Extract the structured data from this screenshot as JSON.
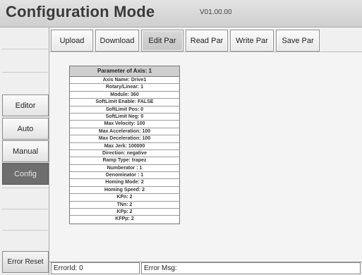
{
  "header": {
    "title": "Configuration Mode",
    "version": "V01.00.00"
  },
  "toolbar": {
    "buttons": [
      {
        "label": "Upload"
      },
      {
        "label": "Download"
      },
      {
        "label": "Edit Par"
      },
      {
        "label": "Read Par"
      },
      {
        "label": "Write Par"
      },
      {
        "label": "Save Par"
      }
    ],
    "active": "Edit Par"
  },
  "nav": {
    "items": [
      {
        "label": "Editor"
      },
      {
        "label": "Auto"
      },
      {
        "label": "Manual"
      },
      {
        "label": "Config"
      }
    ],
    "active": "Config",
    "error_reset_label": "Error Reset"
  },
  "panel": {
    "title": "Parameter of Axis: 1",
    "rows": [
      "Axis Name: Drive1",
      "Rotary/Linear: 1",
      "Module: 360",
      "SoftLimit Enable: FALSE",
      "SoftLimit Pos: 0",
      "SoftLimit Neg: 0",
      "Max Velocity: 100",
      "Max Acceleration: 100",
      "Max Deceleration: 100",
      "Max Jerk: 100000",
      "Direction: negative",
      "Ramp Type: trapez",
      "Numberator : 1",
      "Denominator : 1",
      "Homing Mode: 2",
      "Homing Speed: 2",
      "KPn: 2",
      "TNn: 2",
      "KPp: 2",
      "KFPp: 2"
    ]
  },
  "status": {
    "error_id_label": "ErrorId: 0",
    "error_msg_label": "Error Msg:"
  }
}
